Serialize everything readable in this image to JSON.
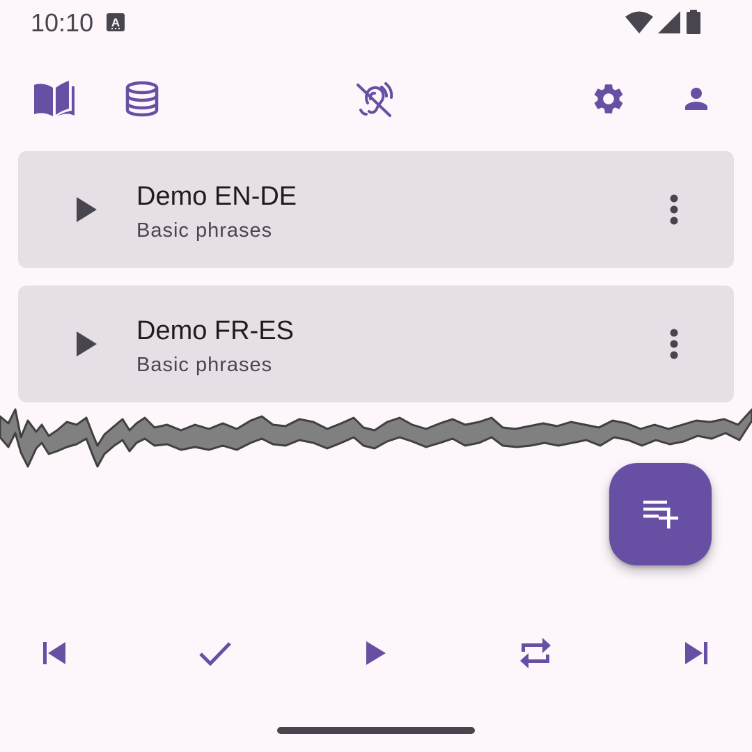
{
  "status_bar": {
    "time": "10:10",
    "icons": [
      "keyboard-a-icon",
      "wifi-icon",
      "cellular-signal-icon",
      "battery-icon"
    ]
  },
  "toolbar": {
    "icons": [
      "book-open-icon",
      "database-icon",
      "hearing-disabled-icon",
      "settings-gear-icon",
      "account-person-icon"
    ]
  },
  "decks": [
    {
      "title": "Demo EN-DE",
      "subtitle": "Basic phrases"
    },
    {
      "title": "Demo FR-ES",
      "subtitle": "Basic phrases"
    }
  ],
  "fab": {
    "icon": "playlist-add-icon"
  },
  "controls": {
    "icons": [
      "skip-previous-icon",
      "check-icon",
      "play-icon",
      "repeat-icon",
      "skip-next-icon"
    ]
  },
  "colors": {
    "accent": "#6750a4",
    "background": "#fdf7fc",
    "card": "#e6e0e6",
    "title_text": "#1d1b20",
    "secondary_text": "#49454f"
  }
}
